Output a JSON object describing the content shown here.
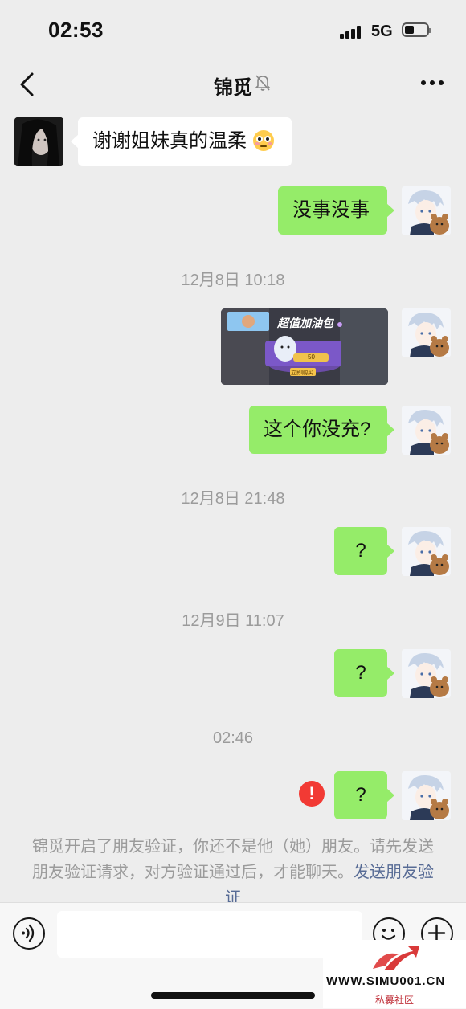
{
  "status_bar": {
    "time": "02:53",
    "network": "5G"
  },
  "nav": {
    "title": "锦觅",
    "back_icon": "chevron-left-icon",
    "mute_icon": "bell-muted-icon",
    "more_icon": "more-dots-icon"
  },
  "messages": [
    {
      "from": "her",
      "text": "谢谢姐妹真的温柔"
    },
    {
      "from": "me",
      "text": "没事没事"
    },
    {
      "type": "timestamp",
      "text": "12月8日 10:18"
    },
    {
      "from": "me",
      "type": "image",
      "image_text": {
        "title": "超值加油包",
        "badge": "立即购买",
        "value": "50"
      }
    },
    {
      "from": "me",
      "text": "这个你没充?"
    },
    {
      "type": "timestamp",
      "text": "12月8日 21:48"
    },
    {
      "from": "me",
      "text": "?"
    },
    {
      "type": "timestamp",
      "text": "12月9日 11:07"
    },
    {
      "from": "me",
      "text": "?"
    },
    {
      "type": "timestamp",
      "text": "02:46"
    },
    {
      "from": "me",
      "text": "?",
      "failed": true
    }
  ],
  "error_icon_text": "!",
  "system_note": {
    "text": "锦觅开启了朋友验证，你还不是他（她）朋友。请先发送朋友验证请求，对方验证通过后，才能聊天。",
    "link": "发送朋友验证"
  },
  "input_bar": {
    "placeholder": "",
    "voice_icon": "voice-icon",
    "emoji_icon": "emoji-icon",
    "plus_icon": "plus-icon"
  },
  "watermark": {
    "url": "WWW.SIMU001.CN",
    "sub": "私募社区"
  },
  "colors": {
    "my_bubble": "#95ec69",
    "her_bubble": "#ffffff",
    "background": "#ededed",
    "link": "#576b95",
    "error": "#f23a34"
  }
}
